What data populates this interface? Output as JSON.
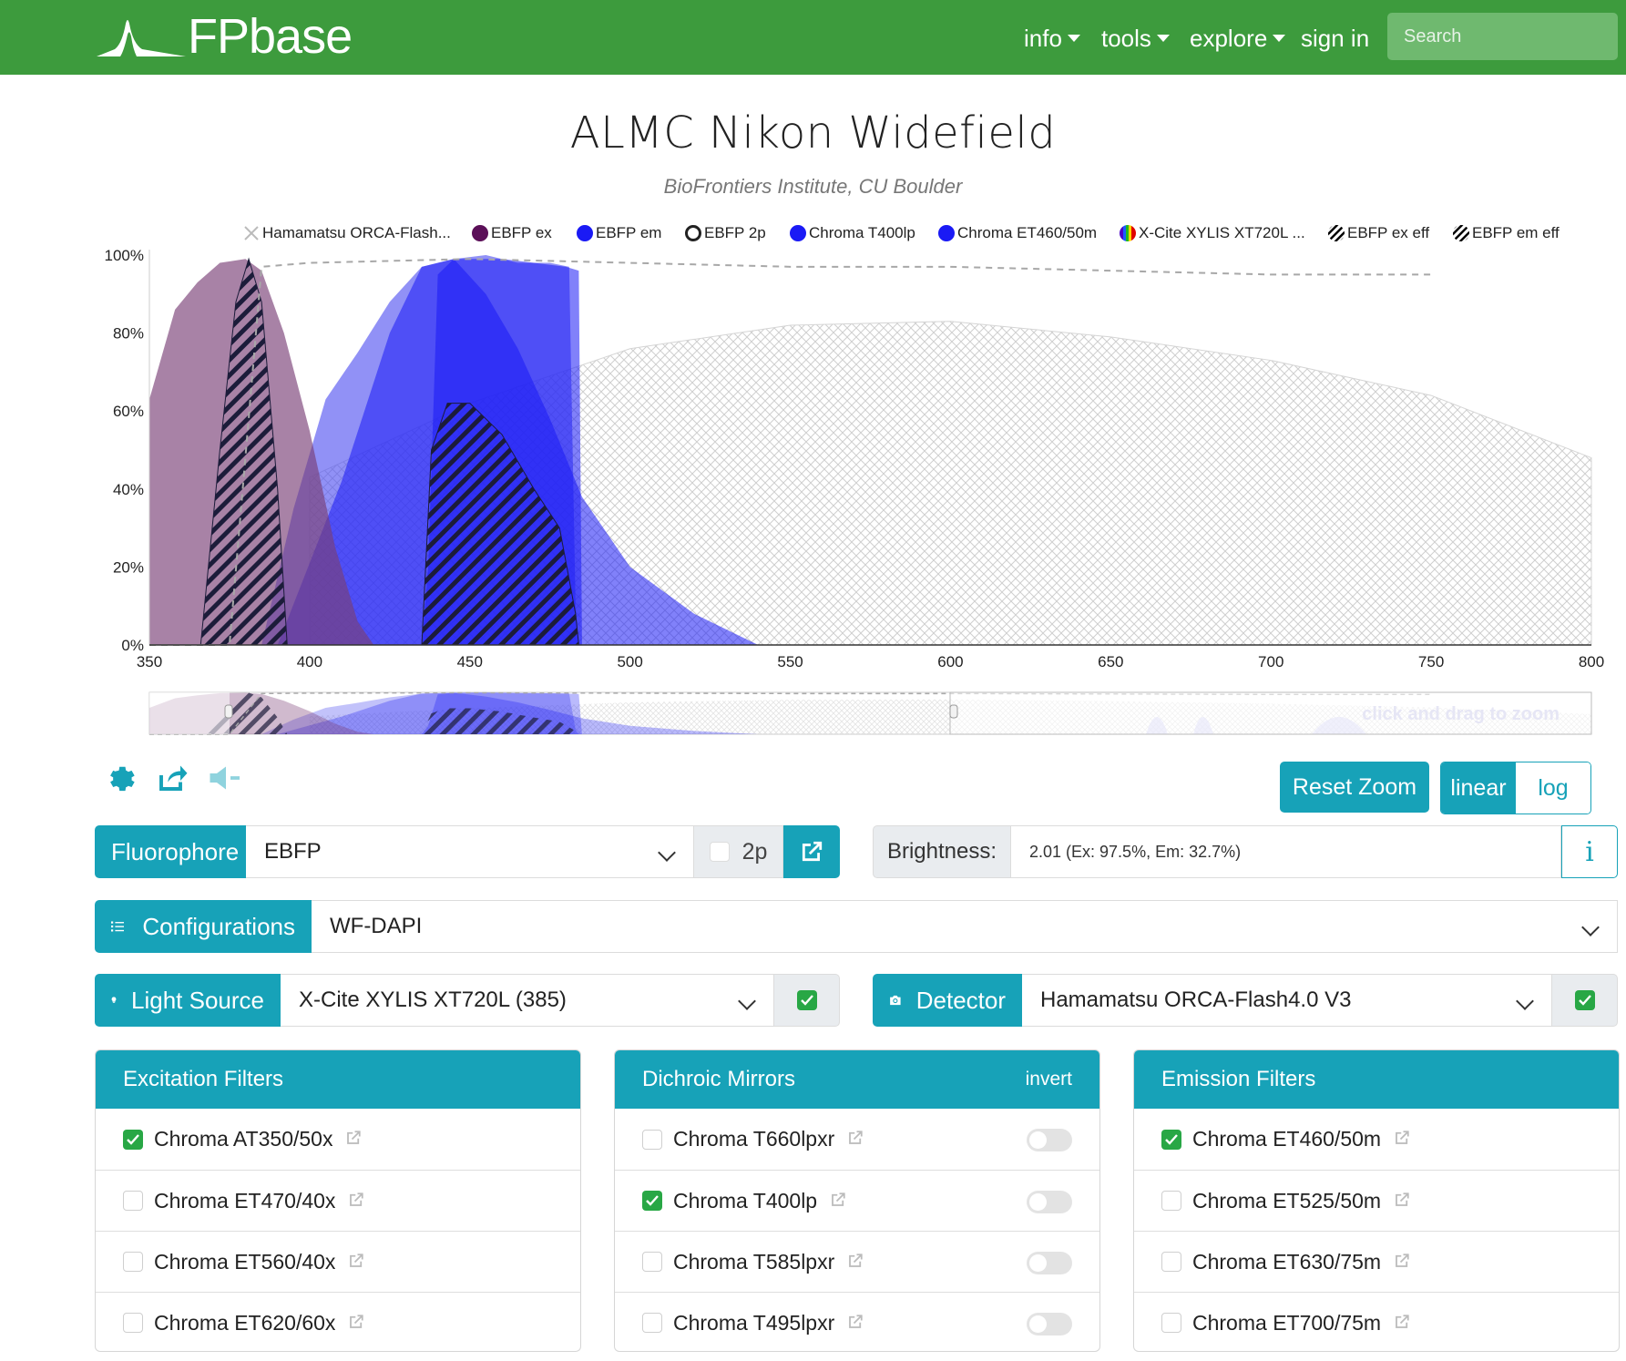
{
  "nav": {
    "brand_fp": "FP",
    "brand_base": "base",
    "items": [
      "info",
      "tools",
      "explore",
      "sign in"
    ],
    "search_placeholder": "Search"
  },
  "page": {
    "title": "ALMC Nikon Widefield",
    "subtitle": "BioFrontiers Institute, CU Boulder"
  },
  "legend": [
    {
      "label": "Hamamatsu ORCA-Flash...",
      "color": "#bdbdbd",
      "style": "cross-hatch"
    },
    {
      "label": "EBFP ex",
      "color": "#5b0f58",
      "style": "solid"
    },
    {
      "label": "EBFP em",
      "color": "#1a1af5",
      "style": "solid"
    },
    {
      "label": "EBFP 2p",
      "color": "#5b0f58",
      "style": "ring"
    },
    {
      "label": "Chroma T400lp",
      "color": "#1a1af5",
      "style": "solid"
    },
    {
      "label": "Chroma ET460/50m",
      "color": "#1a1af5",
      "style": "solid"
    },
    {
      "label": "X-Cite XYLIS XT720L ...",
      "color": "#e00000",
      "style": "rainbow"
    },
    {
      "label": "EBFP ex eff",
      "color": "#000000",
      "style": "hatch"
    },
    {
      "label": "EBFP em eff",
      "color": "#000000",
      "style": "hatch"
    }
  ],
  "chart_data": {
    "type": "area",
    "x_unit": "nm",
    "xlim": [
      350,
      800
    ],
    "ylim": [
      0,
      100
    ],
    "x_ticks": [
      "350",
      "400",
      "450",
      "500",
      "550",
      "600",
      "650",
      "700",
      "750",
      "800"
    ],
    "y_ticks": [
      "0%",
      "20%",
      "40%",
      "60%",
      "80%",
      "100%"
    ],
    "grid": false,
    "legend_position": "top",
    "series": [
      {
        "name": "Hamamatsu ORCA-Flash...",
        "color": "#cccccc",
        "fill": "cross-hatch",
        "x": [
          400,
          450,
          500,
          550,
          600,
          650,
          700,
          750,
          800
        ],
        "y": [
          43,
          62,
          76,
          82,
          83,
          79,
          73,
          64,
          48
        ]
      },
      {
        "name": "EBFP ex",
        "color": "#7a3f76",
        "fill": "solid",
        "x": [
          350,
          358,
          365,
          372,
          380,
          385,
          392,
          400,
          408,
          415,
          420
        ],
        "y": [
          63,
          86,
          93,
          98,
          99,
          96,
          80,
          55,
          25,
          6,
          0
        ]
      },
      {
        "name": "EBFP em",
        "color": "#1a1af5",
        "fill": "solid",
        "x": [
          390,
          410,
          425,
          435,
          445,
          455,
          465,
          475,
          485,
          500,
          520,
          540
        ],
        "y": [
          0,
          42,
          80,
          97,
          99,
          90,
          76,
          58,
          38,
          20,
          8,
          0
        ]
      },
      {
        "name": "Chroma T400lp",
        "color": "#1a1af5",
        "fill": "solid",
        "x": [
          385,
          395,
          405,
          415,
          425,
          435,
          445,
          455,
          465,
          475,
          481,
          483,
          484
        ],
        "y": [
          0,
          35,
          63,
          75,
          88,
          97,
          99,
          100,
          98,
          98,
          97,
          10,
          0
        ]
      },
      {
        "name": "Chroma ET460/50m",
        "color": "#1a1af5",
        "fill": "solid",
        "x": [
          435,
          437,
          440,
          445,
          460,
          470,
          480,
          484,
          485
        ],
        "y": [
          0,
          20,
          95,
          99,
          99,
          98,
          97,
          96,
          0
        ]
      },
      {
        "name": "X-Cite XYLIS XT720L ...",
        "color": "#999999",
        "fill": "dashed-line",
        "x": [
          350,
          375,
          385,
          400,
          450,
          500,
          550,
          600,
          650,
          700,
          750
        ],
        "y": [
          0,
          0,
          97,
          98,
          99,
          98,
          97,
          97,
          96,
          95,
          95
        ]
      },
      {
        "name": "EBFP ex eff",
        "color": "#000000",
        "fill": "hatch",
        "x": [
          366,
          372,
          377,
          381,
          385,
          390,
          393
        ],
        "y": [
          0,
          50,
          88,
          99,
          88,
          40,
          0
        ]
      },
      {
        "name": "EBFP em eff",
        "color": "#000000",
        "fill": "hatch",
        "x": [
          435,
          438,
          443,
          450,
          460,
          470,
          478,
          483,
          484
        ],
        "y": [
          0,
          50,
          62,
          62,
          54,
          40,
          30,
          8,
          0
        ]
      }
    ],
    "navigator": {
      "hint": "click and drag to zoom"
    }
  },
  "controls": {
    "reset_zoom": "Reset Zoom",
    "scale_linear": "linear",
    "scale_log": "log",
    "fluorophore_label": "Fluorophore",
    "fluorophore_value": "EBFP",
    "twop_label": "2p",
    "twop_checked": false,
    "brightness_label": "Brightness:",
    "brightness_value": "2.01 (Ex: 97.5%, Em: 32.7%)",
    "info_icon_label": "i",
    "configurations_label": "Configurations",
    "configurations_value": "WF-DAPI",
    "light_source_label": "Light Source",
    "light_source_value": "X-Cite XYLIS XT720L (385)",
    "light_source_enabled": true,
    "detector_label": "Detector",
    "detector_value": "Hamamatsu ORCA-Flash4.0 V3",
    "detector_enabled": true
  },
  "cards": {
    "excitation": {
      "title": "Excitation Filters",
      "items": [
        {
          "label": "Chroma AT350/50x",
          "checked": true
        },
        {
          "label": "Chroma ET470/40x",
          "checked": false
        },
        {
          "label": "Chroma ET560/40x",
          "checked": false
        },
        {
          "label": "Chroma ET620/60x",
          "checked": false
        }
      ]
    },
    "dichroic": {
      "title": "Dichroic Mirrors",
      "invert_label": "invert",
      "items": [
        {
          "label": "Chroma T660lpxr",
          "checked": false,
          "inverted": false
        },
        {
          "label": "Chroma T400lp",
          "checked": true,
          "inverted": false
        },
        {
          "label": "Chroma T585lpxr",
          "checked": false,
          "inverted": false
        },
        {
          "label": "Chroma T495lpxr",
          "checked": false,
          "inverted": false
        }
      ]
    },
    "emission": {
      "title": "Emission Filters",
      "items": [
        {
          "label": "Chroma ET460/50m",
          "checked": true
        },
        {
          "label": "Chroma ET525/50m",
          "checked": false
        },
        {
          "label": "Chroma ET630/75m",
          "checked": false
        },
        {
          "label": "Chroma ET700/75m",
          "checked": false
        }
      ]
    }
  }
}
